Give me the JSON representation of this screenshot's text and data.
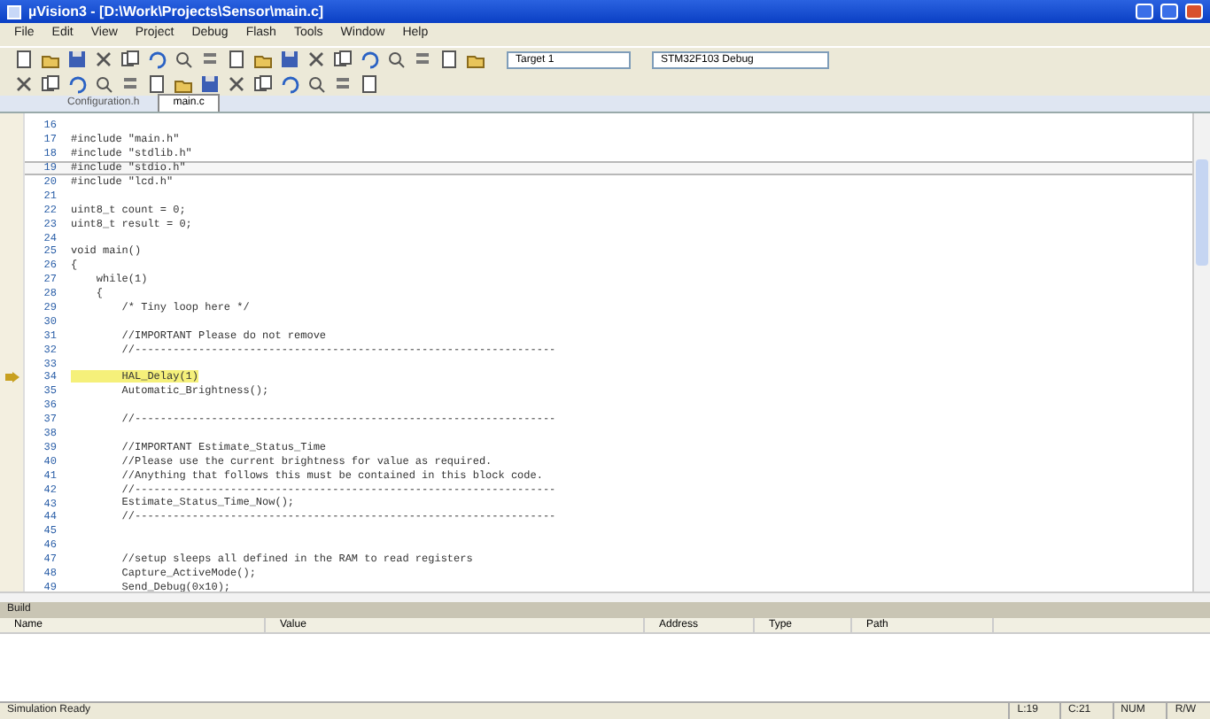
{
  "window": {
    "title": "µVision3 - [D:\\Work\\Projects\\Sensor\\main.c]"
  },
  "menu": [
    "File",
    "Edit",
    "View",
    "Project",
    "Debug",
    "Flash",
    "Tools",
    "Window",
    "Help"
  ],
  "toolbar": {
    "target": "Target 1",
    "config": "STM32F103 Debug"
  },
  "tabs": [
    {
      "label": "Configuration.h",
      "selected": false
    },
    {
      "label": "main.c",
      "selected": true
    }
  ],
  "code": [
    {
      "num": "16",
      "highlighted": false,
      "selected": false
    },
    {
      "num": "17",
      "text": "#include \"main.h\"",
      "highlighted": false,
      "selected": false
    },
    {
      "num": "18",
      "text": "#include \"stdlib.h\"",
      "highlighted": false,
      "selected": false
    },
    {
      "num": "19",
      "text": "#include \"stdio.h\"",
      "highlighted": false,
      "selected": true
    },
    {
      "num": "20",
      "text": "#include \"lcd.h\"",
      "highlighted": false,
      "selected": false
    },
    {
      "num": "21",
      "highlighted": false,
      "selected": false
    },
    {
      "num": "22",
      "text": "uint8_t count = 0;",
      "highlighted": false,
      "selected": false
    },
    {
      "num": "23",
      "text": "uint8_t result = 0;",
      "highlighted": false,
      "selected": false
    },
    {
      "num": "24",
      "highlighted": false,
      "selected": false
    },
    {
      "num": "25",
      "text": "void main()",
      "highlighted": false,
      "selected": false
    },
    {
      "num": "26",
      "text": "{",
      "highlighted": false,
      "selected": false
    },
    {
      "num": "27",
      "text": "    while(1)",
      "highlighted": false,
      "selected": false
    },
    {
      "num": "28",
      "text": "    {",
      "highlighted": false,
      "selected": false
    },
    {
      "num": "29",
      "text": "        /* Tiny loop here */",
      "highlighted": false,
      "selected": false
    },
    {
      "num": "30",
      "highlighted": false,
      "selected": false
    },
    {
      "num": "31",
      "text": "        //IMPORTANT Please do not remove",
      "highlighted": false,
      "selected": false
    },
    {
      "num": "32",
      "text": "        //------------------------------------------------------------------",
      "highlighted": false,
      "selected": false
    },
    {
      "num": "33",
      "highlighted": false,
      "selected": false
    },
    {
      "num": "34",
      "text": "        HAL_Delay(1)",
      "highlighted": true,
      "selected": false
    },
    {
      "num": "35",
      "text": "        Automatic_Brightness();",
      "highlighted": false,
      "selected": false
    },
    {
      "num": "36",
      "highlighted": false,
      "selected": false
    },
    {
      "num": "37",
      "text": "        //------------------------------------------------------------------",
      "highlighted": false,
      "selected": false
    },
    {
      "num": "38",
      "highlighted": false,
      "selected": false
    },
    {
      "num": "39",
      "text": "        //IMPORTANT Estimate_Status_Time",
      "highlighted": false,
      "selected": false
    },
    {
      "num": "40",
      "text": "        //Please use the current brightness for value as required.",
      "highlighted": false,
      "selected": false
    },
    {
      "num": "41",
      "text": "        //Anything that follows this must be contained in this block code.",
      "highlighted": false,
      "selected": false
    },
    {
      "num": "42",
      "text": "        //------------------------------------------------------------------",
      "highlighted": false,
      "selected": false
    },
    {
      "num": "43",
      "text": "        Estimate_Status_Time_Now();",
      "highlighted": false,
      "selected": false
    },
    {
      "num": "44",
      "text": "        //------------------------------------------------------------------",
      "highlighted": false,
      "selected": false
    },
    {
      "num": "45",
      "highlighted": false,
      "selected": false
    },
    {
      "num": "46",
      "highlighted": false,
      "selected": false
    },
    {
      "num": "47",
      "text": "        //setup sleeps all defined in the RAM to read registers",
      "highlighted": false,
      "selected": false
    },
    {
      "num": "48",
      "text": "        Capture_ActiveMode();",
      "highlighted": false,
      "selected": false
    },
    {
      "num": "49",
      "text": "        Send_Debug(0x10);",
      "highlighted": false,
      "selected": false
    }
  ],
  "build_panel": {
    "title": "Build",
    "columns": [
      "Name",
      "Value",
      "Address",
      "Type",
      "Path"
    ]
  },
  "status_bar": {
    "left": "Simulation Ready",
    "right": [
      "L:19",
      "C:21",
      "NUM",
      "R/W"
    ]
  }
}
